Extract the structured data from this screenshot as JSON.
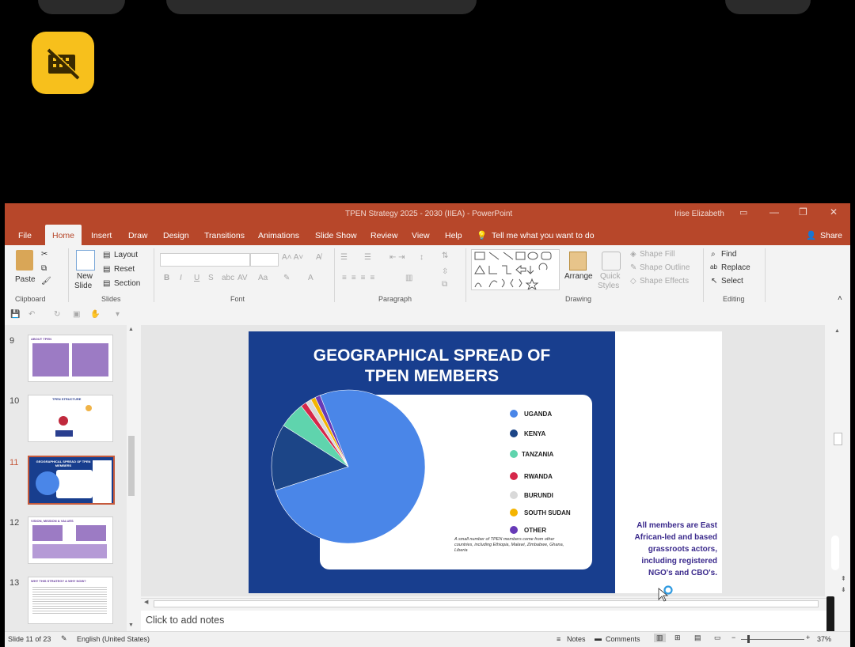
{
  "window": {
    "title": "TPEN Strategy 2025 - 2030 (IIEA)  -  PowerPoint",
    "user": "Irise Elizabeth"
  },
  "menu": {
    "items": [
      "File",
      "Home",
      "Insert",
      "Draw",
      "Design",
      "Transitions",
      "Animations",
      "Slide Show",
      "Review",
      "View",
      "Help"
    ],
    "active": "Home",
    "tell_me": "Tell me what you want to do",
    "share": "Share"
  },
  "ribbon": {
    "clipboard": {
      "paste": "Paste",
      "label": "Clipboard"
    },
    "slides": {
      "new_slide": "New",
      "new_slide2": "Slide",
      "layout": "Layout",
      "reset": "Reset",
      "section": "Section",
      "label": "Slides"
    },
    "font": {
      "label": "Font"
    },
    "paragraph": {
      "label": "Paragraph"
    },
    "drawing": {
      "arrange": "Arrange",
      "quick": "Quick",
      "styles": "Styles",
      "shape_fill": "Shape Fill",
      "shape_outline": "Shape Outline",
      "shape_effects": "Shape Effects",
      "label": "Drawing"
    },
    "editing": {
      "find": "Find",
      "replace": "Replace",
      "select": "Select",
      "label": "Editing"
    }
  },
  "thumbnails": [
    {
      "num": "9",
      "title": "ABOUT TPEN"
    },
    {
      "num": "10",
      "title": "TPEN STRUCTURE"
    },
    {
      "num": "11",
      "title": "GEOGRAPHICAL SPREAD OF TPEN MEMBERS"
    },
    {
      "num": "12",
      "title": "VISION, MISSION & VALUES"
    },
    {
      "num": "13",
      "title": "WHY THIS STRATEGY & WHY NOW?"
    }
  ],
  "slide": {
    "title_line1": "GEOGRAPHICAL SPREAD OF",
    "title_line2": "TPEN MEMBERS",
    "footnote": "A small number of TPEN members come from other countries, including Ethiopia, Malawi, Zimbabwe, Ghana, Liberia",
    "side_text": "All members are East African-led and based grassroots actors, including registered NGO's and CBO's."
  },
  "chart_data": {
    "type": "pie",
    "categories": [
      "UGANDA",
      "KENYA",
      "TANZANIA",
      "RWANDA",
      "BURUNDI",
      "SOUTH SUDAN",
      "OTHER"
    ],
    "values": [
      76,
      14,
      5.5,
      1.2,
      1.2,
      1.0,
      1.1
    ],
    "colors": [
      "#4a86e8",
      "#1c4587",
      "#5fd4ad",
      "#d6274a",
      "#d9d9d9",
      "#f4b400",
      "#673ab7"
    ],
    "legend": "right"
  },
  "notes": {
    "placeholder": "Click to add notes"
  },
  "status": {
    "slide": "Slide 11 of 23",
    "language": "English (United States)",
    "notes": "Notes",
    "comments": "Comments",
    "zoom": "37%"
  }
}
